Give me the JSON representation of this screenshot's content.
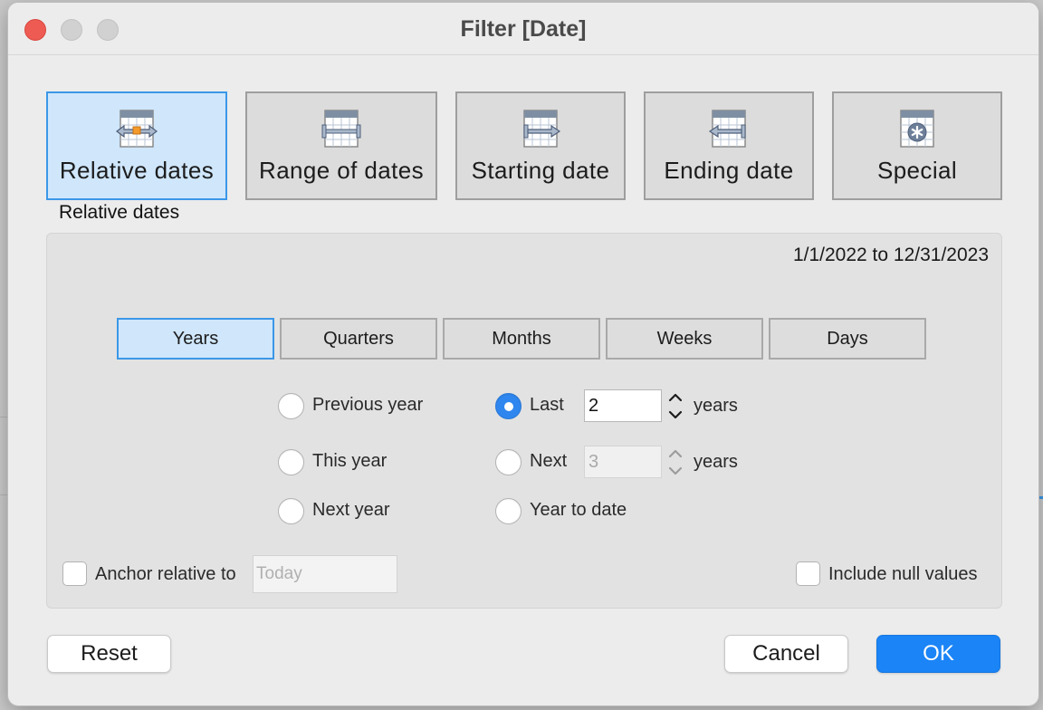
{
  "window": {
    "title": "Filter [Date]"
  },
  "mode_buttons": [
    {
      "label": "Relative dates",
      "icon": "relative-dates-calendar-icon",
      "selected": true
    },
    {
      "label": "Range of dates",
      "icon": "range-of-dates-calendar-icon",
      "selected": false
    },
    {
      "label": "Starting date",
      "icon": "starting-date-calendar-icon",
      "selected": false
    },
    {
      "label": "Ending date",
      "icon": "ending-date-calendar-icon",
      "selected": false
    },
    {
      "label": "Special",
      "icon": "special-calendar-icon",
      "selected": false
    }
  ],
  "section_label": "Relative dates",
  "date_range_text": "1/1/2022 to 12/31/2023",
  "period_tabs": [
    {
      "label": "Years",
      "selected": true
    },
    {
      "label": "Quarters",
      "selected": false
    },
    {
      "label": "Months",
      "selected": false
    },
    {
      "label": "Weeks",
      "selected": false
    },
    {
      "label": "Days",
      "selected": false
    }
  ],
  "options_left": [
    {
      "label": "Previous year",
      "checked": false
    },
    {
      "label": "This year",
      "checked": false
    },
    {
      "label": "Next year",
      "checked": false
    }
  ],
  "options_right": {
    "last": {
      "label": "Last",
      "checked": true,
      "value": "2",
      "unit": "years"
    },
    "next": {
      "label": "Next",
      "checked": false,
      "value": "3",
      "unit": "years",
      "disabled": true
    },
    "year_to_date": {
      "label": "Year to date",
      "checked": false
    }
  },
  "anchor": {
    "label": "Anchor relative to",
    "checked": false,
    "placeholder": "Today"
  },
  "include_null": {
    "label": "Include null values",
    "checked": false
  },
  "buttons": {
    "reset": "Reset",
    "cancel": "Cancel",
    "ok": "OK"
  },
  "colors": {
    "accent": "#1b84f6",
    "selected_fill": "#cfe6fb",
    "selected_border": "#3b97e8",
    "close": "#ee5b52"
  }
}
